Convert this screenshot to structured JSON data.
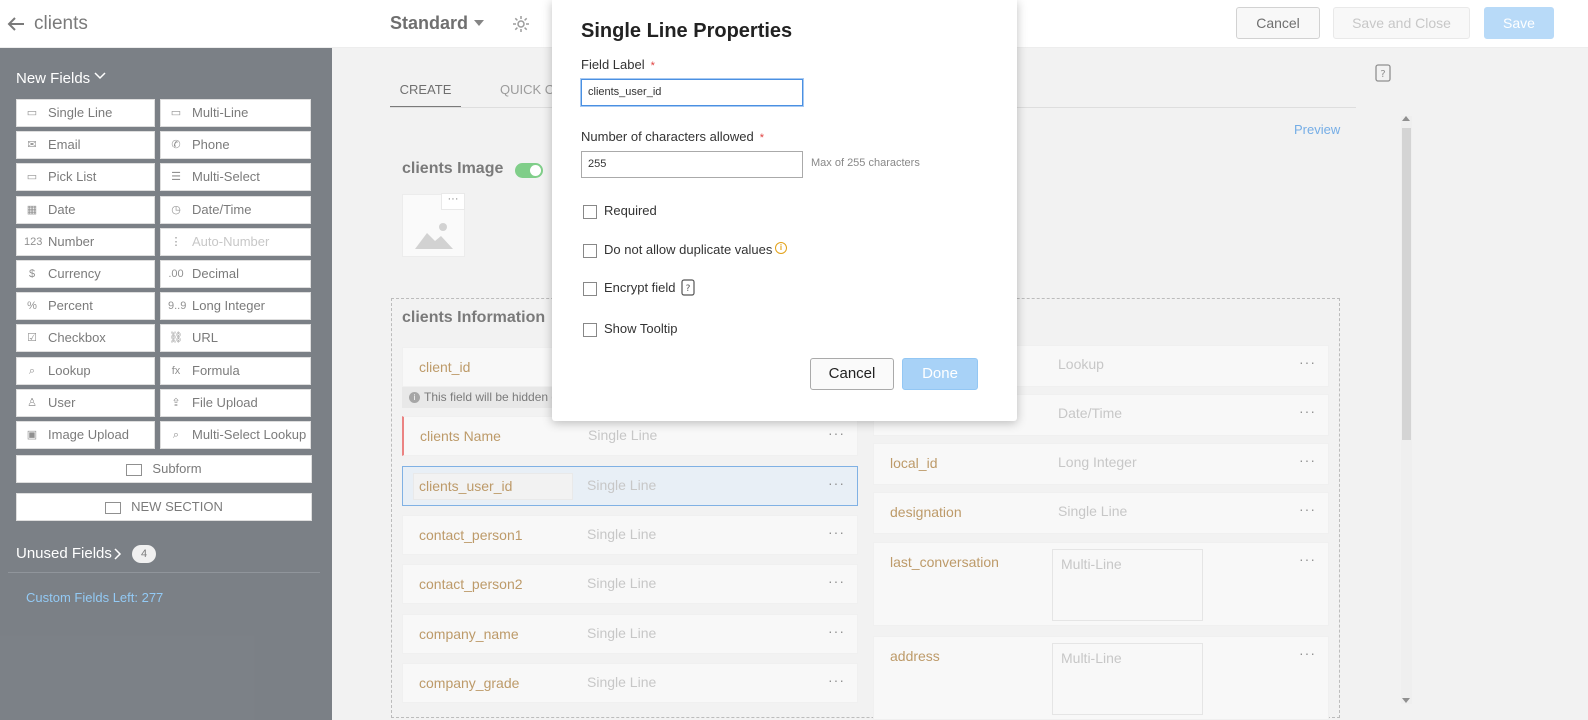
{
  "header": {
    "module_name": "clients",
    "layout_name": "Standard",
    "cancel_label": "Cancel",
    "save_close_label": "Save and Close",
    "save_label": "Save"
  },
  "sidebar": {
    "new_fields_label": "New Fields",
    "palette": [
      {
        "label": "Single Line",
        "icon": "single-line-icon",
        "glyph": "▭"
      },
      {
        "label": "Multi-Line",
        "icon": "multi-line-icon",
        "glyph": "▭"
      },
      {
        "label": "Email",
        "icon": "email-icon",
        "glyph": "✉"
      },
      {
        "label": "Phone",
        "icon": "phone-icon",
        "glyph": "✆"
      },
      {
        "label": "Pick List",
        "icon": "pick-list-icon",
        "glyph": "▭"
      },
      {
        "label": "Multi-Select",
        "icon": "multi-select-icon",
        "glyph": "☰"
      },
      {
        "label": "Date",
        "icon": "date-icon",
        "glyph": "▦"
      },
      {
        "label": "Date/Time",
        "icon": "date-time-icon",
        "glyph": "◷"
      },
      {
        "label": "Number",
        "icon": "number-icon",
        "glyph": "123"
      },
      {
        "label": "Auto-Number",
        "icon": "auto-number-icon",
        "glyph": "⋮"
      },
      {
        "label": "Currency",
        "icon": "currency-icon",
        "glyph": "$"
      },
      {
        "label": "Decimal",
        "icon": "decimal-icon",
        "glyph": ".00"
      },
      {
        "label": "Percent",
        "icon": "percent-icon",
        "glyph": "%"
      },
      {
        "label": "Long Integer",
        "icon": "long-integer-icon",
        "glyph": "9..9"
      },
      {
        "label": "Checkbox",
        "icon": "checkbox-icon",
        "glyph": "☑"
      },
      {
        "label": "URL",
        "icon": "url-icon",
        "glyph": "⛓"
      },
      {
        "label": "Lookup",
        "icon": "lookup-icon",
        "glyph": "⌕"
      },
      {
        "label": "Formula",
        "icon": "formula-icon",
        "glyph": "fx"
      },
      {
        "label": "User",
        "icon": "user-icon",
        "glyph": "♙"
      },
      {
        "label": "File Upload",
        "icon": "file-upload-icon",
        "glyph": "⇪"
      },
      {
        "label": "Image Upload",
        "icon": "image-upload-icon",
        "glyph": "▣"
      },
      {
        "label": "Multi-Select Lookup",
        "icon": "multi-select-lookup-icon",
        "glyph": "⌕"
      }
    ],
    "subform_label": "Subform",
    "new_section_label": "NEW SECTION",
    "unused_fields_label": "Unused Fields",
    "unused_count": "4",
    "custom_fields_left": "Custom Fields Left: 277"
  },
  "tabs": {
    "create": "CREATE",
    "quick": "QUICK C"
  },
  "preview_label": "Preview",
  "image_section_title": "clients Image",
  "info_section_title": "clients Information",
  "hidden_hint": "This field will be hidden d",
  "left_fields": [
    {
      "label": "client_id",
      "type": ""
    },
    {
      "label": "clients Name",
      "type": "Single Line"
    },
    {
      "label": "clients_user_id",
      "type": "Single Line"
    },
    {
      "label": "contact_person1",
      "type": "Single Line"
    },
    {
      "label": "contact_person2",
      "type": "Single Line"
    },
    {
      "label": "company_name",
      "type": "Single Line"
    },
    {
      "label": "company_grade",
      "type": "Single Line"
    }
  ],
  "right_fields": [
    {
      "label": "",
      "type": "Lookup"
    },
    {
      "label": "",
      "type": "Date/Time"
    },
    {
      "label": "local_id",
      "type": "Long Integer"
    },
    {
      "label": "designation",
      "type": "Single Line"
    },
    {
      "label": "last_conversation",
      "type": "Multi-Line"
    },
    {
      "label": "address",
      "type": "Multi-Line"
    }
  ],
  "dots": "···",
  "modal": {
    "title": "Single Line Properties",
    "field_label_caption": "Field Label",
    "field_label_value": "clients_user_id",
    "chars_caption": "Number of characters allowed",
    "chars_value": "255",
    "max_hint": "Max of 255 characters",
    "required_label": "Required",
    "no_duplicates_label": "Do not allow duplicate values",
    "encrypt_label": "Encrypt field",
    "tooltip_label": "Show Tooltip",
    "cancel_label": "Cancel",
    "done_label": "Done",
    "required_star": "*"
  }
}
